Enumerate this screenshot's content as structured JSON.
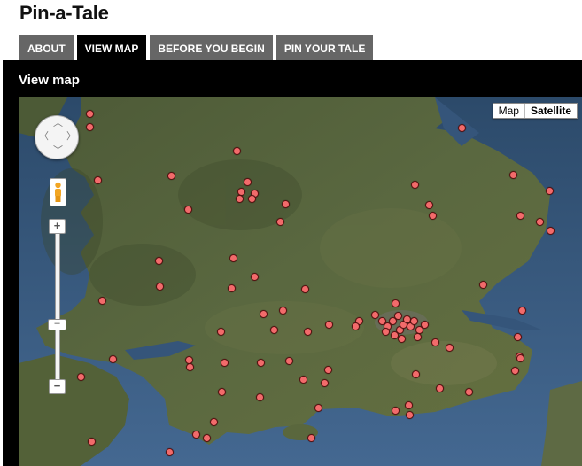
{
  "site": {
    "title": "Pin-a-Tale"
  },
  "tabs": [
    {
      "label": "ABOUT"
    },
    {
      "label": "VIEW MAP",
      "active": true
    },
    {
      "label": "BEFORE YOU BEGIN"
    },
    {
      "label": "PIN YOUR TALE"
    }
  ],
  "panel": {
    "title": "View map"
  },
  "map": {
    "type_buttons": {
      "map": "Map",
      "satellite": "Satellite",
      "selected": "Satellite"
    },
    "zoom": {
      "in": "+",
      "out": "−"
    },
    "pin_color": "#f26b6b",
    "pin_count": 96
  },
  "colors": {
    "accent_tab_active": "#000000",
    "tab_inactive": "#666666",
    "sea": "#3b5a78",
    "land": "#4f5e3a"
  }
}
